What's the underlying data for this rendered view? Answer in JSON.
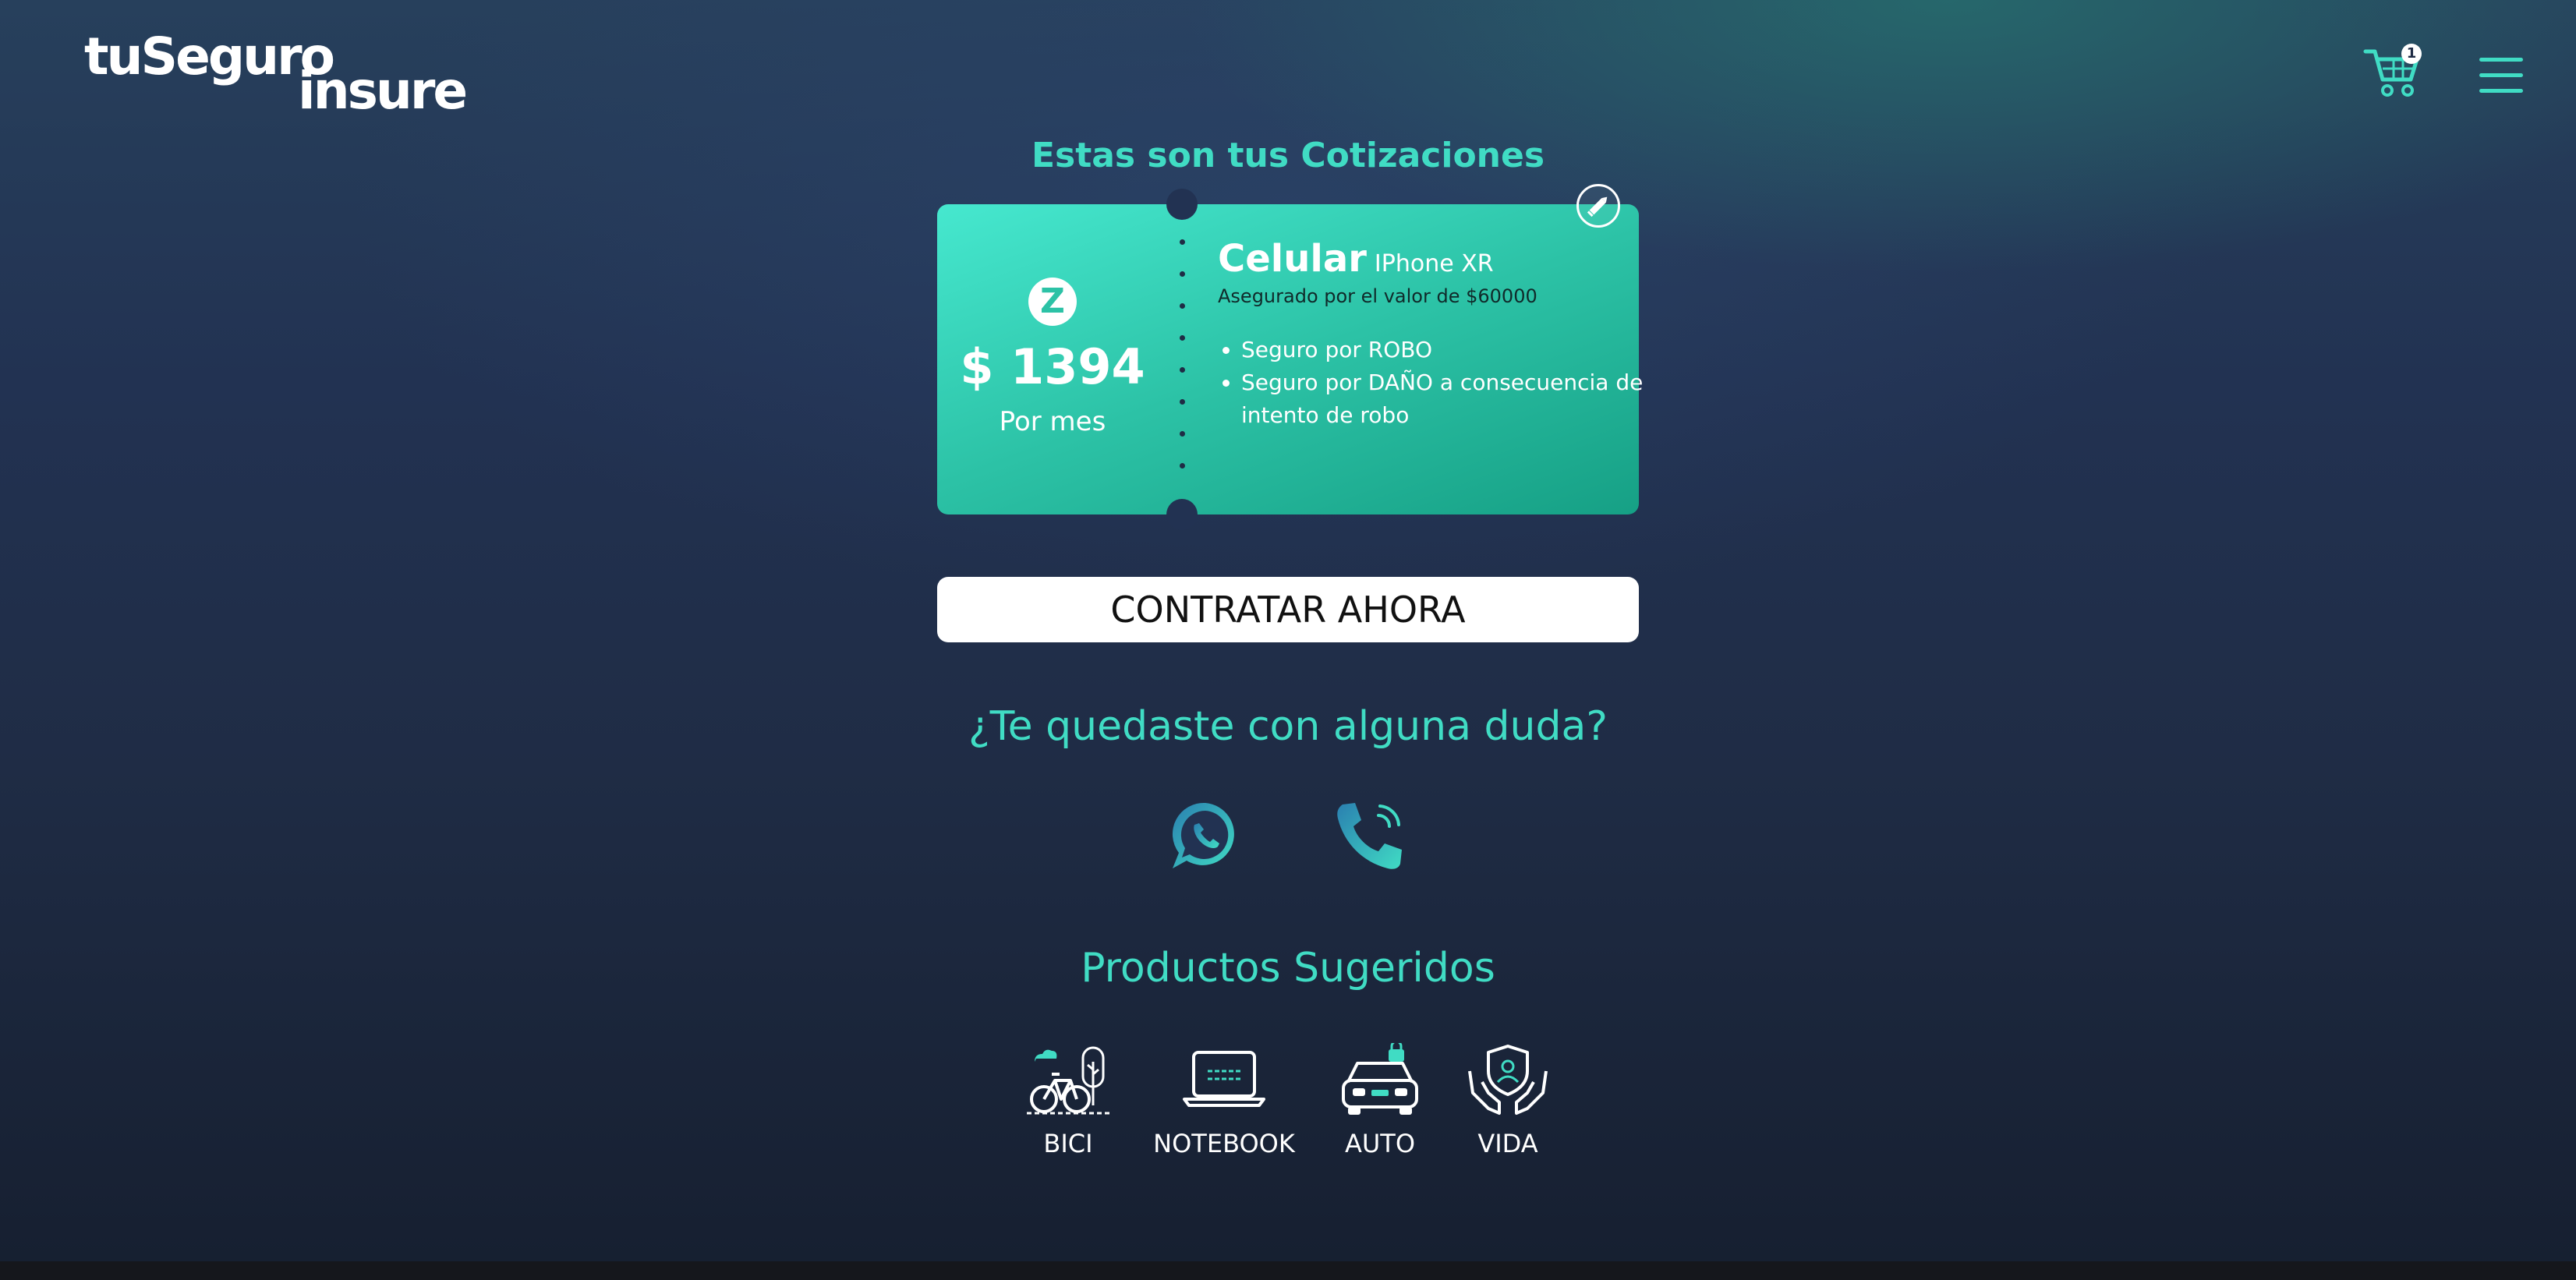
{
  "header": {
    "logo_line1": "tuSeguro",
    "logo_line2": "insure",
    "cart_count": "1"
  },
  "quote": {
    "title": "Estas son tus Cotizaciones",
    "insurer_logo_letter": "Z",
    "price": "$ 1394",
    "period": "Por mes",
    "product_type": "Celular",
    "product_model": "IPhone XR",
    "insured_value": "Asegurado por el valor de $60000",
    "coverage": [
      "Seguro por ROBO",
      "Seguro por DAÑO a consecuencia de intento de robo"
    ]
  },
  "cta": {
    "label": "CONTRATAR AHORA"
  },
  "help": {
    "title": "¿Te quedaste con alguna duda?"
  },
  "suggested": {
    "title": "Productos Sugeridos",
    "items": [
      {
        "label": "BICI",
        "icon": "bike-icon"
      },
      {
        "label": "NOTEBOOK",
        "icon": "notebook-icon"
      },
      {
        "label": "AUTO",
        "icon": "car-icon"
      },
      {
        "label": "VIDA",
        "icon": "life-icon"
      }
    ]
  },
  "colors": {
    "accent": "#40dcc4",
    "ticket_start": "#46e8cf",
    "ticket_end": "#16a085",
    "background_top": "#27405c",
    "background_bottom": "#161f30"
  }
}
